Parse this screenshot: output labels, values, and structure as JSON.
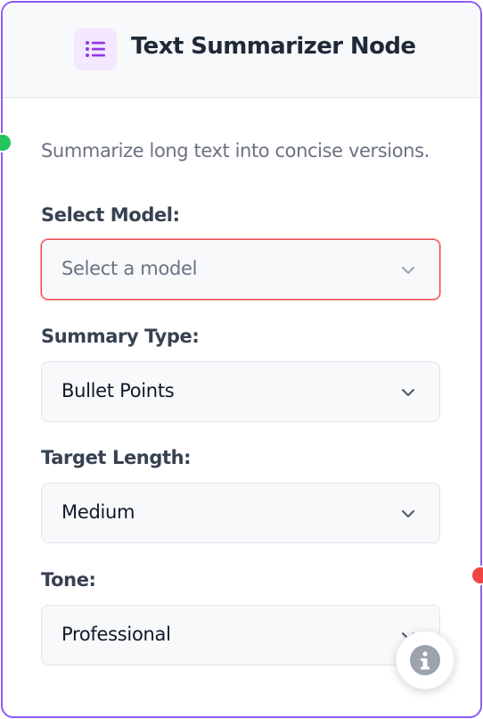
{
  "node": {
    "title": "Text Summarizer Node",
    "icon": "list-icon",
    "description": "Summarize long text into concise versions."
  },
  "fields": {
    "model": {
      "label": "Select Model:",
      "placeholder": "Select a model",
      "value": ""
    },
    "summary_type": {
      "label": "Summary Type:",
      "value": "Bullet Points"
    },
    "target_length": {
      "label": "Target Length:",
      "value": "Medium"
    },
    "tone": {
      "label": "Tone:",
      "value": "Professional"
    }
  },
  "colors": {
    "accent": "#8b5cf6",
    "input_handle": "#22c55e",
    "output_handle": "#ef4444",
    "error_border": "#ef4444"
  }
}
